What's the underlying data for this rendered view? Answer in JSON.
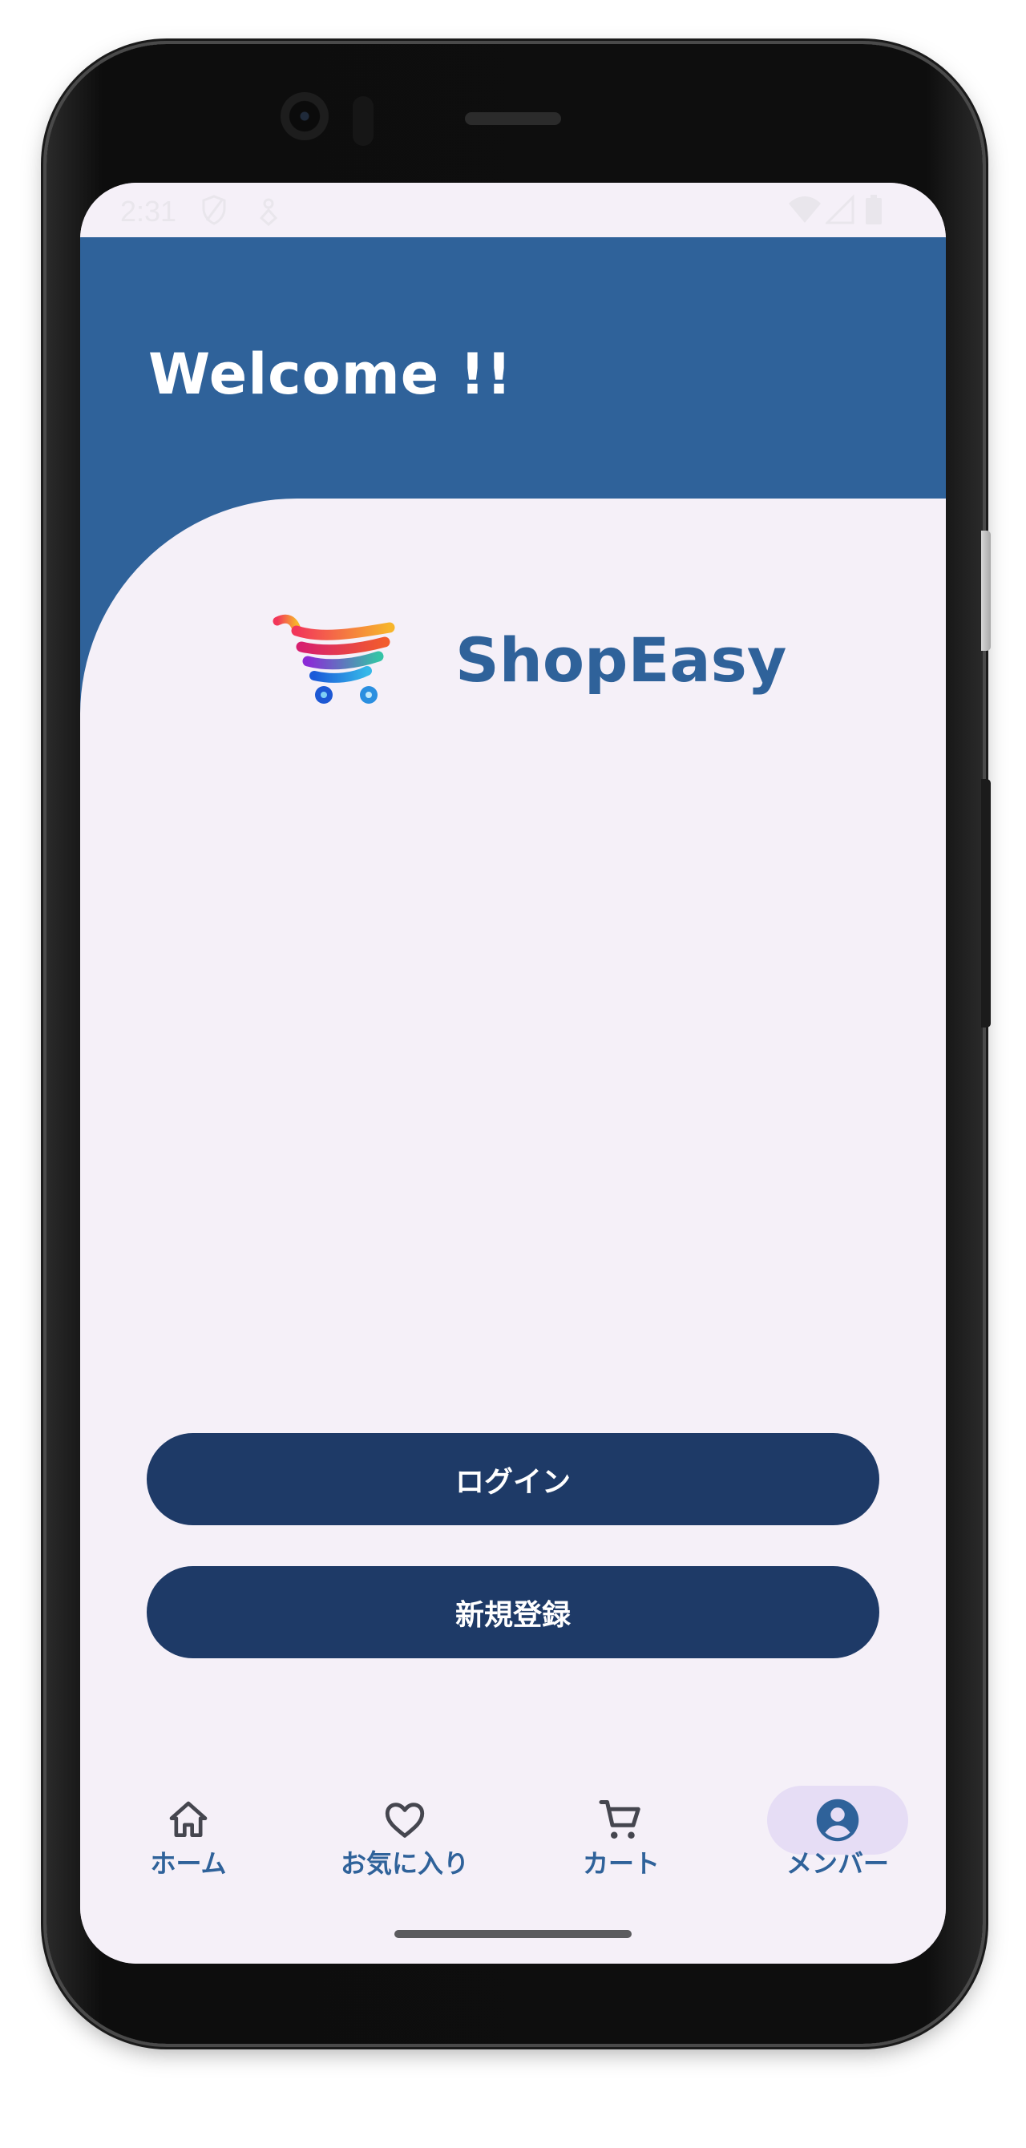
{
  "status_bar": {
    "time": "2:31"
  },
  "header": {
    "title": "Welcome !!"
  },
  "brand": {
    "name": "ShopEasy",
    "logo_icon": "rainbow-shopping-cart-icon"
  },
  "actions": {
    "login_label": "ログイン",
    "register_label": "新規登録"
  },
  "bottom_nav": {
    "items": [
      {
        "label": "ホーム",
        "icon": "home-icon"
      },
      {
        "label": "お気に入り",
        "icon": "heart-icon"
      },
      {
        "label": "カート",
        "icon": "cart-icon"
      },
      {
        "label": "メンバー",
        "icon": "account-circle-icon",
        "active": true
      }
    ]
  },
  "colors": {
    "primary": "#2f629a",
    "button": "#1e3a67",
    "background": "#f5f0f8",
    "nav_active_pill": "#e6ddf5"
  }
}
